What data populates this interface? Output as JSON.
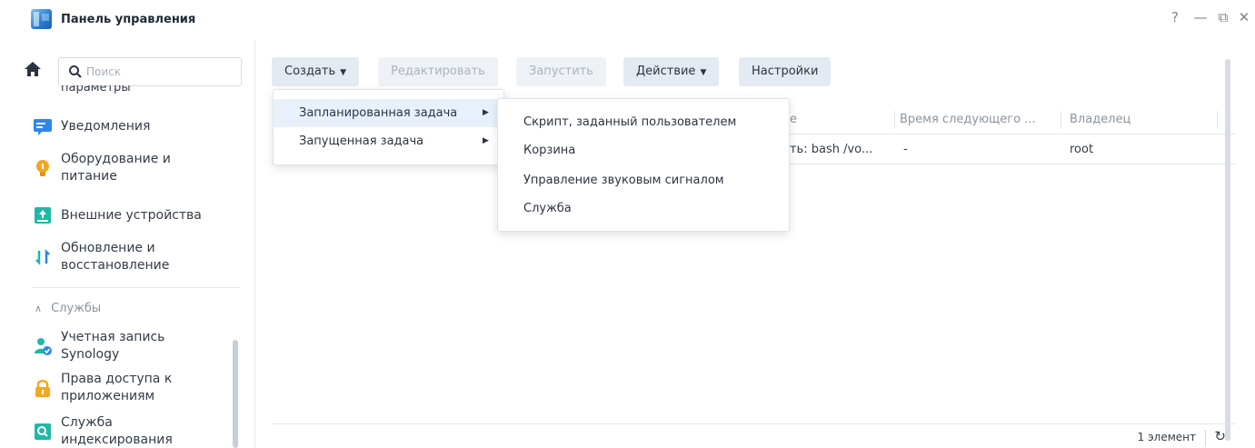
{
  "window": {
    "title": "Панель управления",
    "controls": {
      "help": "?",
      "minimize": "—",
      "maximize": "⧉",
      "close": "✕"
    }
  },
  "sidebar": {
    "search_placeholder": "Поиск",
    "cut_item": "параметры",
    "items": [
      {
        "label": "Уведомления",
        "icon": "notifications-icon",
        "color": "#2f86e6"
      },
      {
        "label": "Оборудование и питание",
        "icon": "lightbulb-icon",
        "color": "#f5a623"
      },
      {
        "label": "Внешние устройства",
        "icon": "external-device-icon",
        "color": "#1fb8a6"
      },
      {
        "label": "Обновление и восстановление",
        "icon": "update-restore-icon",
        "color": "#2f86e6"
      }
    ],
    "section_label": "Службы",
    "services": [
      {
        "label": "Учетная запись Synology",
        "icon": "synology-account-icon",
        "color": "#1fb8a6"
      },
      {
        "label": "Права доступа к приложениям",
        "icon": "lock-icon",
        "color": "#f5a623"
      },
      {
        "label": "Служба индексирования",
        "icon": "indexing-icon",
        "color": "#1fb8a6"
      }
    ]
  },
  "toolbar": {
    "create": "Создать",
    "edit": "Редактировать",
    "run": "Запустить",
    "action": "Действие",
    "settings": "Настройки"
  },
  "table": {
    "columns": [
      "е",
      "Время следующего ...",
      "Владелец"
    ],
    "rows": [
      {
        "cells": [
          "ть: bash /vo...",
          "-",
          "root"
        ]
      }
    ]
  },
  "footer": {
    "count": "1 элемент"
  },
  "create_menu": {
    "items": [
      {
        "label": "Запланированная задача",
        "active": true
      },
      {
        "label": "Запущенная задача",
        "active": false
      }
    ]
  },
  "scheduled_submenu": {
    "items": [
      "Скрипт, заданный пользователем",
      "Корзина",
      "Управление звуковым сигналом",
      "Служба"
    ]
  }
}
